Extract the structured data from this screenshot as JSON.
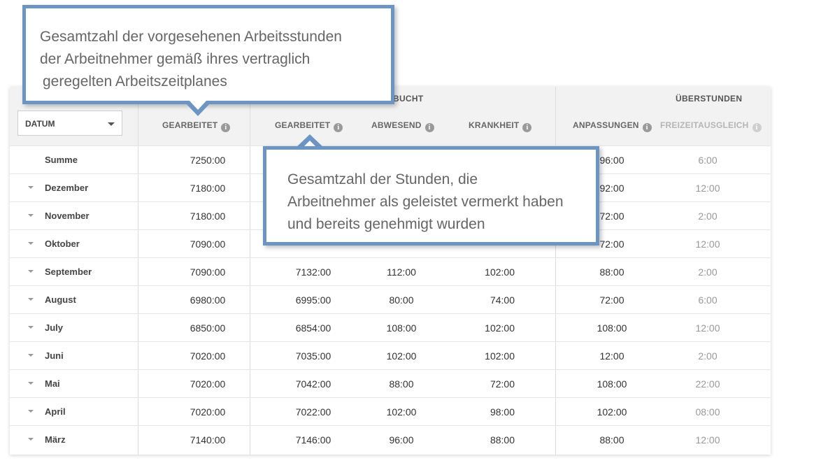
{
  "table": {
    "date_select": "DATUM",
    "groups": {
      "gebucht": "BUCHT",
      "ueberstunden": "ÜBERSTUNDEN"
    },
    "columns": {
      "geplant_gearbeitet": "GEARBEITET",
      "gearbeitet": "GEARBEITET",
      "abwesend": "ABWESEND",
      "krankheit": "KRANKHEIT",
      "anpassungen": "ANPASSUNGEN",
      "freizeitausgleich": "FREIZEITAUSGLEICH"
    },
    "rows": [
      {
        "label": "Summe",
        "plan": "7250:00",
        "work": "",
        "abs": "",
        "sick": "",
        "adj": "96:00",
        "comp": "6:00"
      },
      {
        "label": "Dezember",
        "plan": "7180:00",
        "work": "",
        "abs": "",
        "sick": "",
        "adj": "92:00",
        "comp": "12:00"
      },
      {
        "label": "November",
        "plan": "7180:00",
        "work": "",
        "abs": "",
        "sick": "",
        "adj": "72:00",
        "comp": "2:00"
      },
      {
        "label": "Oktober",
        "plan": "7090:00",
        "work": "",
        "abs": "",
        "sick": "",
        "adj": "72:00",
        "comp": "12:00"
      },
      {
        "label": "September",
        "plan": "7090:00",
        "work": "7132:00",
        "abs": "112:00",
        "sick": "102:00",
        "adj": "88:00",
        "comp": "2:00"
      },
      {
        "label": "August",
        "plan": "6980:00",
        "work": "6995:00",
        "abs": "80:00",
        "sick": "74:00",
        "adj": "72:00",
        "comp": "6:00"
      },
      {
        "label": "July",
        "plan": "6850:00",
        "work": "6854:00",
        "abs": "108:00",
        "sick": "102:00",
        "adj": "108:00",
        "comp": "12:00"
      },
      {
        "label": "Juni",
        "plan": "7020:00",
        "work": "7035:00",
        "abs": "102:00",
        "sick": "102:00",
        "adj": "12:00",
        "comp": "2:00"
      },
      {
        "label": "Mai",
        "plan": "7020:00",
        "work": "7042:00",
        "abs": "88:00",
        "sick": "72:00",
        "adj": "108:00",
        "comp": "22:00"
      },
      {
        "label": "April",
        "plan": "7020:00",
        "work": "7022:00",
        "abs": "102:00",
        "sick": "98:00",
        "adj": "102:00",
        "comp": "08:00"
      },
      {
        "label": "März",
        "plan": "7140:00",
        "work": "7146:00",
        "abs": "96:00",
        "sick": "88:00",
        "adj": "88:00",
        "comp": "12:00"
      }
    ]
  },
  "callouts": {
    "planned": [
      "Gesamtzahl der vorgesehenen  Arbeitsstunden",
      "der Arbeitnehmer gemäß ihres vertraglich",
      "geregelten Arbeitszeitplanes"
    ],
    "worked": [
      "Gesamtzahl der Stunden, die",
      "Arbeitnehmer als geleistet vermerkt haben",
      "und bereits genehmigt wurden"
    ]
  },
  "colors": {
    "callout_border": "#6d95c4",
    "header_bg": "#f2f2f2"
  }
}
